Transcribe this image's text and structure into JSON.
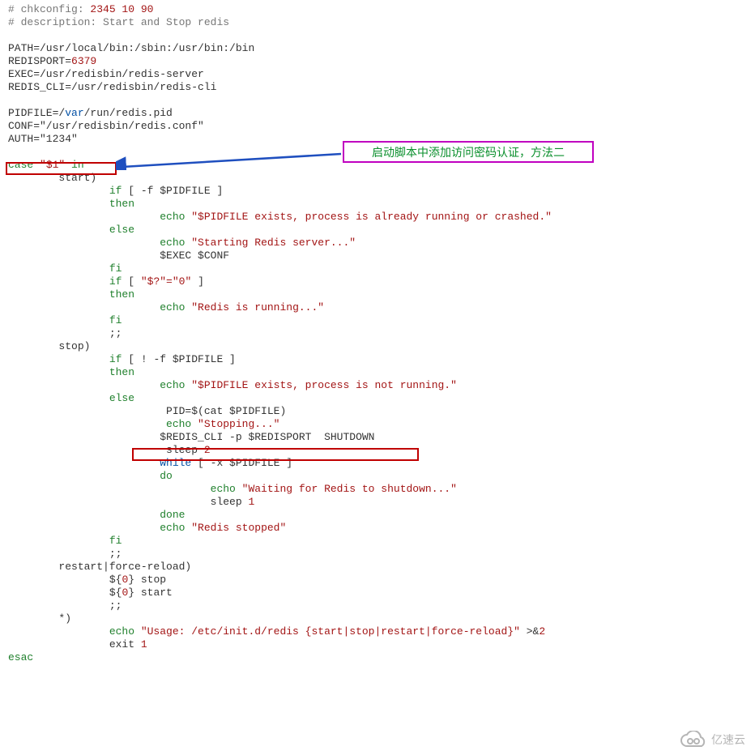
{
  "annotation": {
    "text": "启动脚本中添加访问密码认证，方法二"
  },
  "watermark": {
    "text": "亿速云"
  },
  "script": {
    "shebang_comment": "# chkconfig: ",
    "shebang_nums": "2345 10 90",
    "desc": "# description: Start and Stop redis",
    "path": "PATH=/usr/local/bin:/sbin:/usr/bin:/bin",
    "port_key": "REDISPORT=",
    "port": "6379",
    "exec": "EXEC=/usr/redisbin/redis-server",
    "redis_cli": "REDIS_CLI=/usr/redisbin/redis-cli",
    "pidfile_key": "PIDFILE=/",
    "pidfile_var": "var",
    "pidfile_rest": "/run/redis.pid",
    "conf": "CONF=\"/usr/redisbin/redis.conf\"",
    "auth": "AUTH=\"1234\"",
    "case_kw": "case",
    "case_var": " \"$1\" ",
    "in": "in",
    "start": "        start)",
    "if_open": "                if",
    "if_cond1": " [ -f $PIDFILE ]",
    "then": "                then",
    "echo1": "                        echo ",
    "echo1_str": "\"$PIDFILE exists, process is already running or crashed.\"",
    "else": "                else",
    "echo2": "                        echo ",
    "echo2_str": "\"Starting Redis server...\"",
    "exec_conf": "                        $EXEC $CONF",
    "fi": "                fi",
    "if2_open": "                if",
    "if2_cond": " [ ",
    "if2_inner": "\"$?\"=\"0\"",
    "if2_close": " ]",
    "then2": "                then",
    "echo3": "                        echo ",
    "echo3_str": "\"Redis is running...\"",
    "fi2": "                fi",
    "dsemi": "                ;;",
    "stop": "        stop)",
    "if3_open": "                if",
    "if3_cond": " [ ! -f $PIDFILE ]",
    "then3": "                then",
    "echo4": "                        echo ",
    "echo4_str": "\"$PIDFILE exists, process is not running.\"",
    "else2": "                else",
    "pid_line": "                         PID=$(cat $PIDFILE)",
    "echo5": "                         echo ",
    "echo5_str": "\"Stopping...\"",
    "cli_line": "                        $REDIS_CLI -p $REDISPORT  SHUTDOWN",
    "sleep2": "                         sleep ",
    "n2": "2",
    "while": "                        while",
    "while_cond": " [ -x $PIDFILE ]",
    "do": "                        do",
    "echo6": "                                echo ",
    "echo6_str": "\"Waiting for Redis to shutdown...\"",
    "sleep1": "                                sleep ",
    "n1": "1",
    "done": "                        done",
    "echo7": "                        echo ",
    "echo7_str": "\"Redis stopped\"",
    "fi3": "                fi",
    "dsemi2": "                ;;",
    "restart": "        restart|force-reload)",
    "r1_a": "                ${",
    "r1_b": "0",
    "r1_c": "} stop",
    "r2_a": "                ${",
    "r2_b": "0",
    "r2_c": "} start",
    "dsemi3": "                ;;",
    "star": "        *)",
    "echo_usage": "                echo ",
    "usage_str": "\"Usage: /etc/init.d/redis {start|stop|restart|force-reload}\"",
    "usage_tail": " >&",
    "usage_2": "2",
    "exit": "                exit ",
    "exit_1": "1",
    "esac": "esac"
  }
}
